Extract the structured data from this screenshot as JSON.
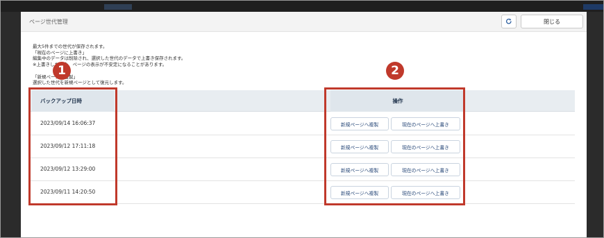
{
  "dialog": {
    "title": "ページ世代管理",
    "close_label": "閉じる",
    "refresh_icon": "refresh-icon"
  },
  "info_lines": [
    "最大5件までの世代が保存されます。",
    "「現在のページに上書き」",
    "編集中のデータは削除され、選択した世代のデータで上書き保存されます。",
    "※上書きした場合、ページの表示が不安定になることがあります。",
    "「新規ページへ複製」",
    "選択した世代を新規ページとして復元します。"
  ],
  "table": {
    "headers": {
      "date": "バックアップ日時",
      "ops": "操作"
    },
    "rows": [
      {
        "date": "2023/09/14 16:06:37"
      },
      {
        "date": "2023/09/12 17:11:18"
      },
      {
        "date": "2023/09/12 13:29:00"
      },
      {
        "date": "2023/09/11 14:20:50"
      }
    ],
    "copy_label": "新規ページへ複製",
    "overwrite_label": "現在のページへ上書き"
  },
  "callouts": [
    "1",
    "2"
  ],
  "colors": {
    "highlight": "#c0392b",
    "header_bg": "#e8edf1",
    "header_text": "#23364f"
  }
}
